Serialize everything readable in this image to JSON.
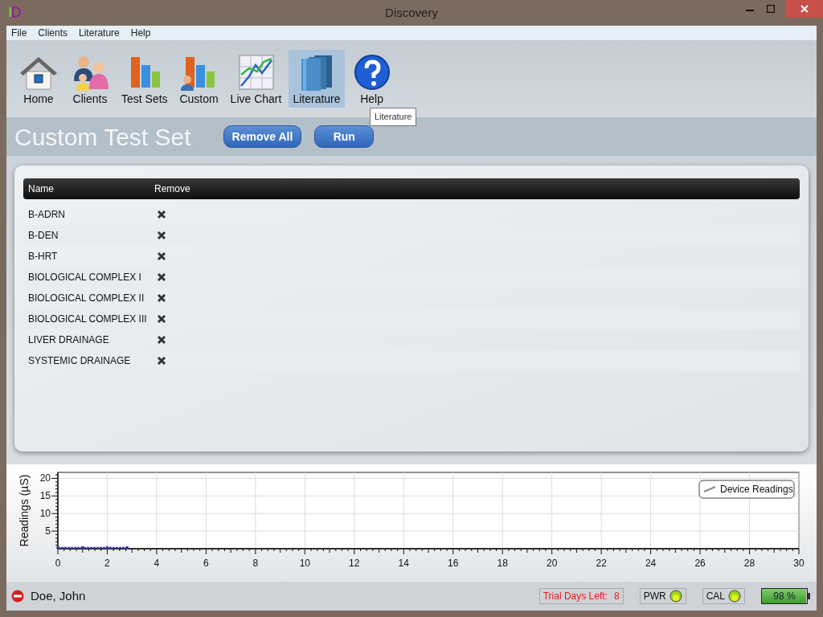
{
  "window": {
    "title": "Discovery"
  },
  "menu": [
    "File",
    "Clients",
    "Literature",
    "Help"
  ],
  "toolbar": [
    {
      "label": "Home",
      "selected": false
    },
    {
      "label": "Clients",
      "selected": false
    },
    {
      "label": "Test Sets",
      "selected": false
    },
    {
      "label": "Custom",
      "selected": false
    },
    {
      "label": "Live Chart",
      "selected": false
    },
    {
      "label": "Literature",
      "selected": true
    },
    {
      "label": "Help",
      "selected": false
    }
  ],
  "tooltip": "Literature",
  "page": {
    "title": "Custom Test Set",
    "buttons": [
      "Remove All",
      "Run"
    ]
  },
  "table": {
    "columns": [
      "Name",
      "Remove"
    ],
    "rows": [
      {
        "name": "B-ADRN"
      },
      {
        "name": "B-DEN"
      },
      {
        "name": "B-HRT"
      },
      {
        "name": "BIOLOGICAL COMPLEX I"
      },
      {
        "name": "BIOLOGICAL COMPLEX II"
      },
      {
        "name": "BIOLOGICAL COMPLEX III"
      },
      {
        "name": "LIVER DRAINAGE"
      },
      {
        "name": "SYSTEMIC DRAINAGE"
      }
    ]
  },
  "chart": {
    "chart_data": {
      "type": "line",
      "ylabel": "Readings (µS)",
      "x": [
        0,
        1,
        2,
        2.8
      ],
      "series": [
        {
          "name": "Device Readings",
          "color": "#3a3ab0",
          "line_style": "dashed",
          "values": [
            0.3,
            0.3,
            0.3,
            0.3
          ]
        }
      ],
      "grid": true,
      "xlim": [
        0,
        30
      ],
      "ylim": [
        0,
        21.7
      ],
      "xticks": [
        0,
        2,
        4,
        6,
        8,
        10,
        12,
        14,
        16,
        18,
        20,
        22,
        24,
        26,
        28,
        30
      ],
      "yticks": [
        5,
        10,
        15,
        20
      ]
    }
  },
  "status_bar": {
    "user": "Doe, John",
    "trial": {
      "label": "Trial Days Left:",
      "value": "8"
    },
    "indicators": [
      {
        "label": "PWR",
        "on": true
      },
      {
        "label": "CAL",
        "on": true
      }
    ],
    "battery": {
      "level": 0.98,
      "reading": "98 %"
    }
  }
}
